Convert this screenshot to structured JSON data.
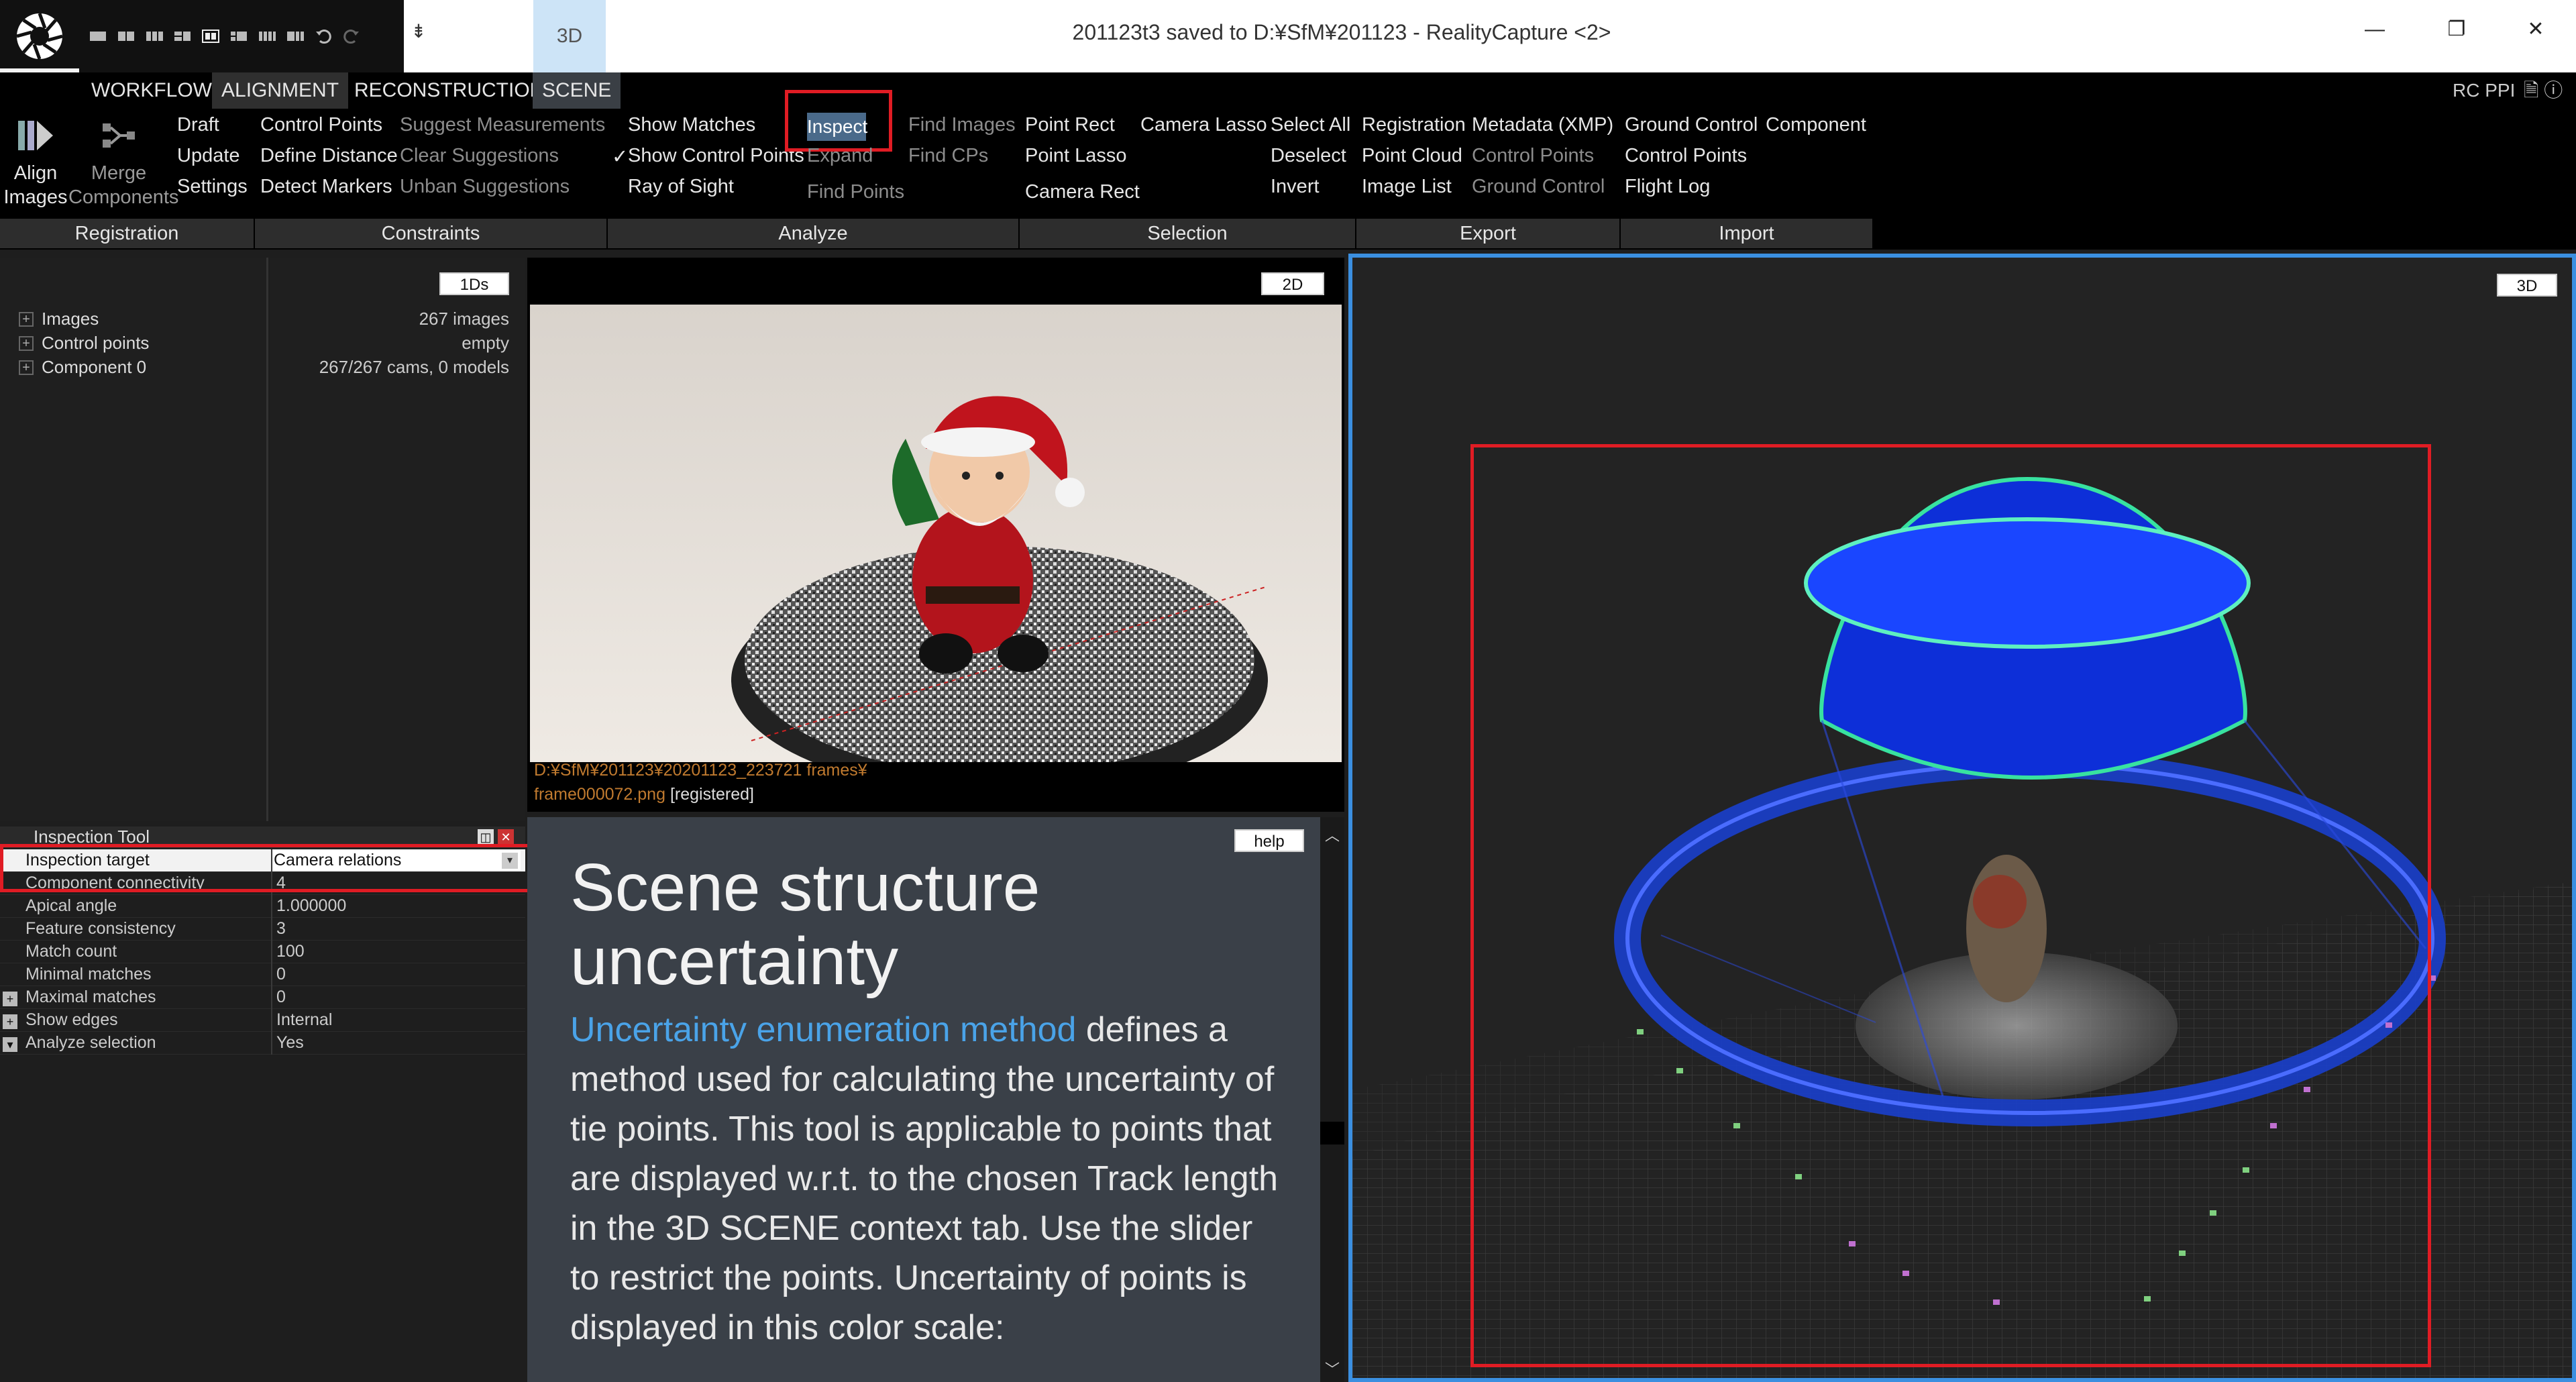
{
  "window": {
    "title": "201123t3 saved to D:¥SfM¥201123 - RealityCapture <2>",
    "tab_3d": "3D",
    "qat_more": "⇟",
    "minimize": "—",
    "restore": "❐",
    "close": "✕"
  },
  "menu_tabs": [
    "WORKFLOW",
    "ALIGNMENT",
    "RECONSTRUCTION",
    "SCENE"
  ],
  "menu_right": {
    "rc_ppi": "RC PPI",
    "icons": "🗎 ⓘ"
  },
  "ribbon": {
    "align": "Align Images",
    "merge": "Merge Components",
    "draft": "Draft",
    "update": "Update",
    "settings": "Settings",
    "control_points": "Control Points",
    "define_distance": "Define Distance",
    "detect_markers": "Detect Markers",
    "suggest_measurements": "Suggest Measurements",
    "clear_suggestions": "Clear Suggestions",
    "unban_suggestions": "Unban Suggestions",
    "show_matches": "Show Matches",
    "show_control_points": "Show Control Points",
    "ray_of_sight": "Ray of Sight",
    "inspect": "Inspect",
    "expand": "Expand",
    "find_points": "Find Points",
    "find_images": "Find Images",
    "find_cps": "Find CPs",
    "point_rect": "Point Rect",
    "point_lasso": "Point Lasso",
    "camera_rect": "Camera Rect",
    "camera_lasso": "Camera Lasso",
    "select_all": "Select All",
    "deselect": "Deselect",
    "invert": "Invert",
    "registration": "Registration",
    "point_cloud": "Point Cloud",
    "image_list": "Image List",
    "metadata_xmp": "Metadata (XMP)",
    "export_control_points": "Control Points",
    "export_ground_control": "Ground Control",
    "import_ground_control": "Ground Control",
    "import_control_points": "Control Points",
    "flight_log": "Flight Log",
    "component": "Component",
    "groups": [
      "Registration",
      "Constraints",
      "Analyze",
      "Selection",
      "Export",
      "Import"
    ]
  },
  "tree": {
    "badge": "1Ds",
    "items": [
      {
        "label": "Images",
        "value": "267 images"
      },
      {
        "label": "Control points",
        "value": "empty"
      },
      {
        "label": "Component 0",
        "value": "267/267 cams, 0 models"
      }
    ]
  },
  "image_view": {
    "badge": "2D",
    "path": "D:¥SfM¥201123¥20201123_223721 frames¥",
    "file": "frame000072.png",
    "status": "[registered]"
  },
  "inspection": {
    "title": "Inspection Tool",
    "rows": [
      {
        "key": "Inspection target",
        "value": "Camera relations"
      },
      {
        "key": "Component connectivity",
        "value": "4"
      },
      {
        "key": "Apical angle",
        "value": "1.000000"
      },
      {
        "key": "Feature consistency",
        "value": "3"
      },
      {
        "key": "Match count",
        "value": "100"
      },
      {
        "key": "Minimal matches",
        "value": "0"
      },
      {
        "key": "Maximal matches",
        "value": "0"
      },
      {
        "key": "Show edges",
        "value": "Internal"
      },
      {
        "key": "Analyze selection",
        "value": "Yes"
      }
    ]
  },
  "help": {
    "button": "help",
    "title": "Scene structure uncertainty",
    "link": "Uncertainty enumeration method",
    "body": " defines a method used for calculating the uncertainty of tie points. This tool is applicable to points that are displayed w.r.t. to the chosen Track length in the 3D SCENE context tab. Use the slider to restrict the points. Uncertainty of points is displayed in this color scale:"
  },
  "view3d": {
    "badge": "3D"
  },
  "colors": {
    "accent": "#3b8fe0",
    "highlight": "#e01c24",
    "link": "#4aa3e8",
    "path": "#c07a2f"
  }
}
